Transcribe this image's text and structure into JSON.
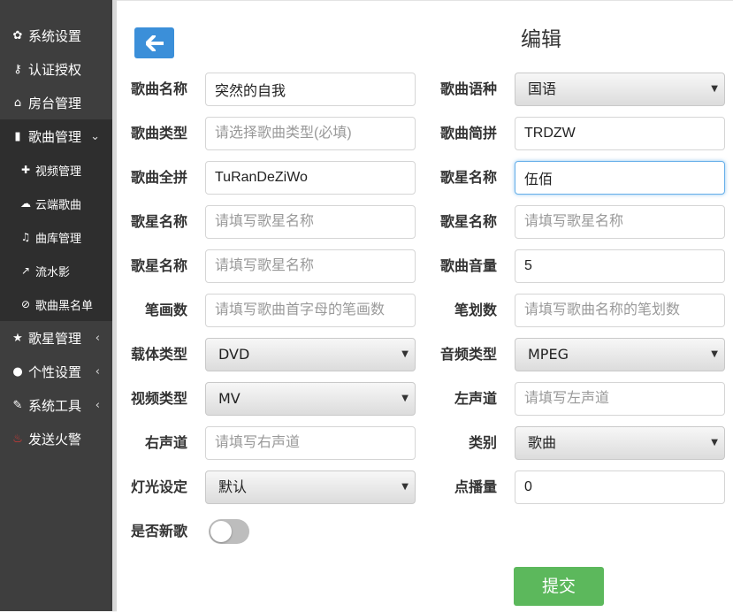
{
  "sidebar": {
    "items": [
      {
        "label": "系统设置",
        "icon": "gear-icon",
        "glyph": "✿"
      },
      {
        "label": "认证授权",
        "icon": "key-icon",
        "glyph": "⚷"
      },
      {
        "label": "房台管理",
        "icon": "home-icon",
        "glyph": "⌂"
      },
      {
        "label": "歌曲管理",
        "icon": "signal-icon",
        "glyph": "▮"
      },
      {
        "label": "歌星管理",
        "icon": "star-icon",
        "glyph": "★"
      },
      {
        "label": "个性设置",
        "icon": "user-icon",
        "glyph": "●"
      },
      {
        "label": "系统工具",
        "icon": "wrench-icon",
        "glyph": "✎"
      },
      {
        "label": "发送火警",
        "icon": "fire-icon",
        "glyph": "♨"
      }
    ],
    "sub_items": [
      {
        "label": "视频管理",
        "glyph": "✚"
      },
      {
        "label": "云端歌曲",
        "glyph": "☁"
      },
      {
        "label": "曲库管理",
        "glyph": "♫"
      },
      {
        "label": "流水影",
        "glyph": "↗"
      },
      {
        "label": "歌曲黑名单",
        "glyph": "⊘"
      }
    ]
  },
  "page": {
    "title": "编辑",
    "submit_label": "提交",
    "back_icon": "arrow-left-icon"
  },
  "form": {
    "song_name": {
      "label": "歌曲名称",
      "value": "突然的自我",
      "placeholder": ""
    },
    "song_language": {
      "label": "歌曲语种",
      "value": "国语"
    },
    "song_type": {
      "label": "歌曲类型",
      "value": "",
      "placeholder": "请选择歌曲类型(必填)"
    },
    "song_abbr": {
      "label": "歌曲简拼",
      "value": "TRDZW",
      "placeholder": ""
    },
    "song_pinyin": {
      "label": "歌曲全拼",
      "value": "TuRanDeZiWo",
      "placeholder": ""
    },
    "singer_1": {
      "label": "歌星名称",
      "value": "伍佰",
      "placeholder": ""
    },
    "singer_2": {
      "label": "歌星名称",
      "value": "",
      "placeholder": "请填写歌星名称"
    },
    "singer_3": {
      "label": "歌星名称",
      "value": "",
      "placeholder": "请填写歌星名称"
    },
    "singer_4": {
      "label": "歌星名称",
      "value": "",
      "placeholder": "请填写歌星名称"
    },
    "song_volume": {
      "label": "歌曲音量",
      "value": "5",
      "placeholder": ""
    },
    "strokes": {
      "label": "笔画数",
      "value": "",
      "placeholder": "请填写歌曲首字母的笔画数"
    },
    "stroke_count": {
      "label": "笔划数",
      "value": "",
      "placeholder": "请填写歌曲名称的笔划数"
    },
    "carrier_type": {
      "label": "载体类型",
      "value": "DVD"
    },
    "audio_type": {
      "label": "音频类型",
      "value": "MPEG"
    },
    "video_type": {
      "label": "视频类型",
      "value": "MV"
    },
    "left_channel": {
      "label": "左声道",
      "value": "",
      "placeholder": "请填写左声道"
    },
    "right_channel": {
      "label": "右声道",
      "value": "",
      "placeholder": "请填写右声道"
    },
    "category": {
      "label": "类别",
      "value": "歌曲"
    },
    "lighting": {
      "label": "灯光设定",
      "value": "默认"
    },
    "play_count": {
      "label": "点播量",
      "value": "0",
      "placeholder": ""
    },
    "is_new": {
      "label": "是否新歌",
      "on": false
    }
  },
  "colors": {
    "sidebar": "#3e3e3e",
    "accent": "#3b8fd9",
    "submit": "#5cb85c"
  }
}
